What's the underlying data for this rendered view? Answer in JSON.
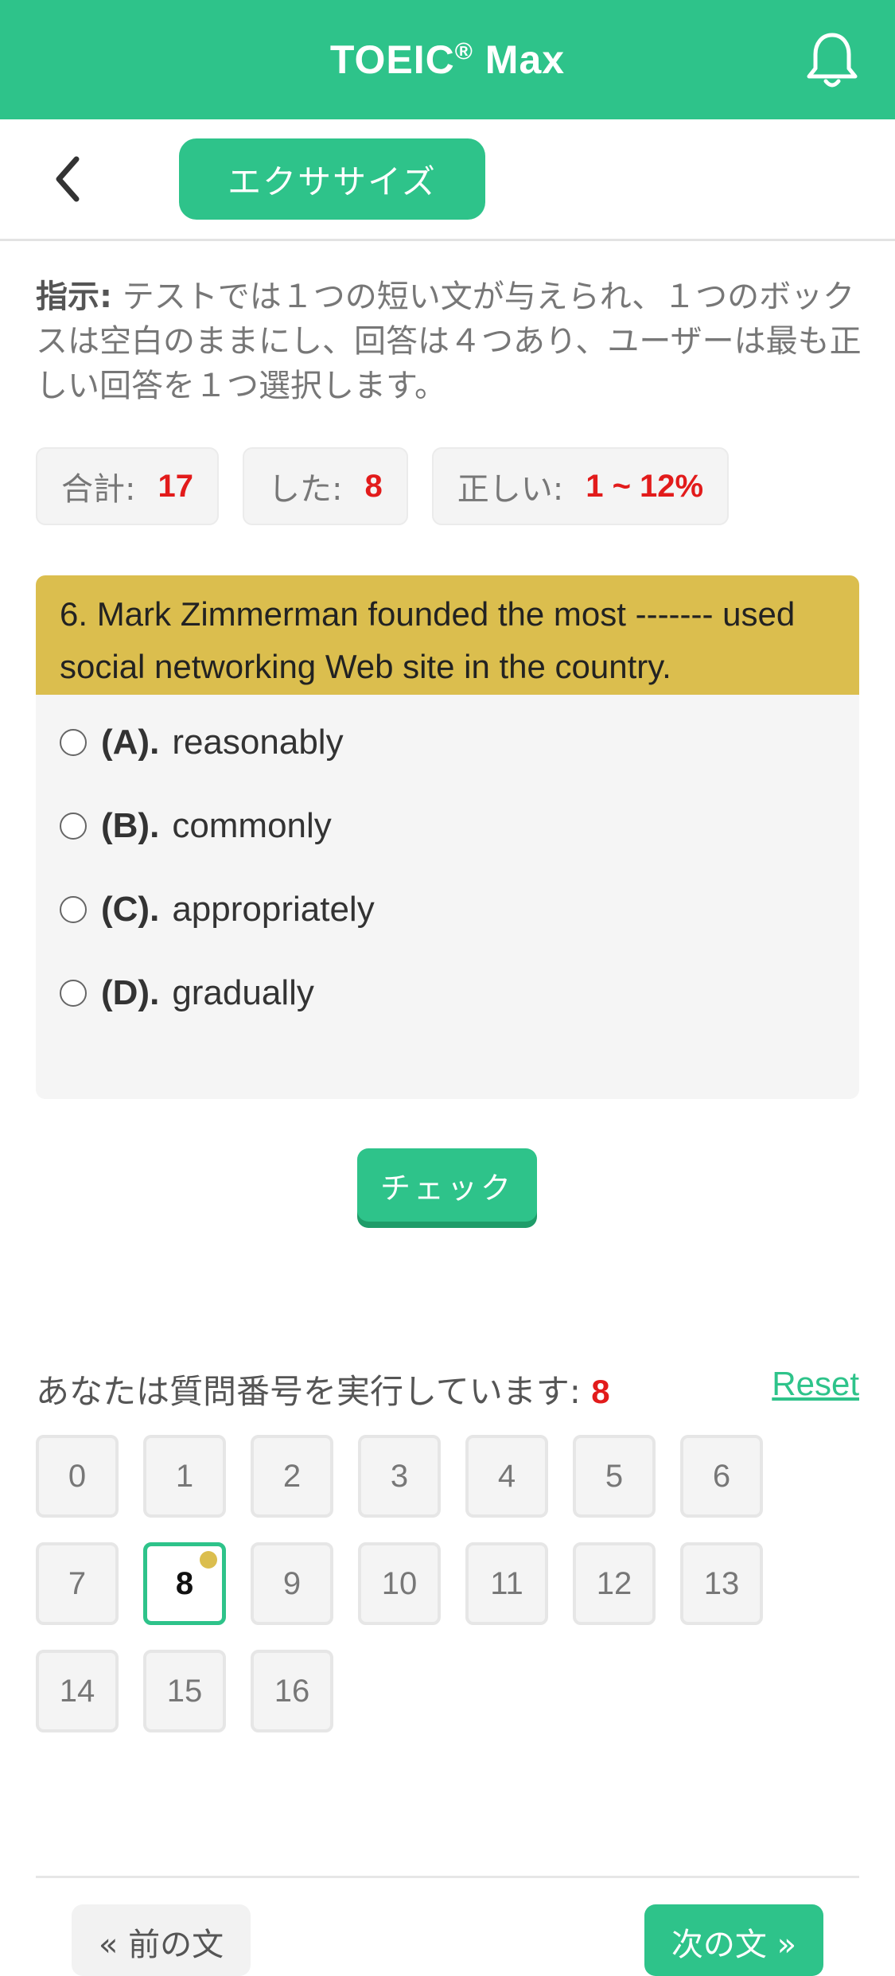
{
  "app": {
    "title": "TOEIC",
    "title_mark": "®",
    "title_suffix": " Max",
    "bell_icon": "bell-icon"
  },
  "nav": {
    "back_icon": "chevron-left-icon",
    "tab_label": "エクササイズ"
  },
  "instruction": {
    "label": "指示:",
    "text": " テストでは１つの短い文が与えられ、１つのボックスは空白のままにし、回答は４つあり、ユーザーは最も正しい回答を１つ選択します。"
  },
  "stats": {
    "total_label": "合計:",
    "total_value": "17",
    "done_label": "した:",
    "done_value": "8",
    "correct_label": "正しい:",
    "correct_value": "1 ~ 12%"
  },
  "question": {
    "text": "6. Mark Zimmerman founded the most ------- used social networking Web site in the country.",
    "options": [
      {
        "label": "(A).",
        "text": "reasonably"
      },
      {
        "label": "(B).",
        "text": "commonly"
      },
      {
        "label": "(C).",
        "text": "appropriately"
      },
      {
        "label": "(D).",
        "text": "gradually"
      }
    ]
  },
  "check_label": "チェック",
  "progress": {
    "running_label": "あなたは質問番号を実行しています:",
    "current": "8",
    "reset_label": "Reset",
    "numbers": [
      "0",
      "1",
      "2",
      "3",
      "4",
      "5",
      "6",
      "7",
      "8",
      "9",
      "10",
      "11",
      "12",
      "13",
      "14",
      "15",
      "16"
    ]
  },
  "footer": {
    "prev_label": "« 前の文",
    "next_label": "次の文 »"
  },
  "colors": {
    "accent": "#2ec38a",
    "question_header": "#dbbe4e",
    "highlight": "#e21b1b"
  }
}
